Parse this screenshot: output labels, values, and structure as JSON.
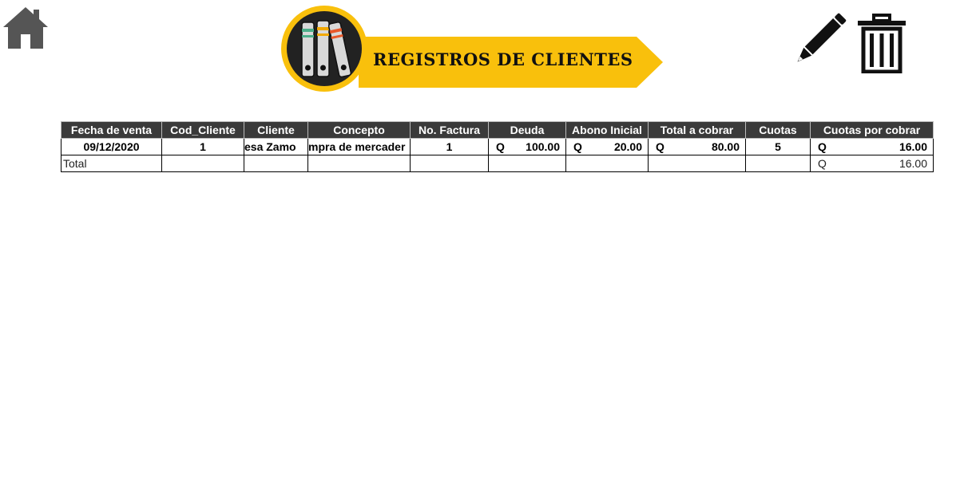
{
  "header": {
    "title": "REGISTROS DE CLIENTES",
    "home_icon": "home-icon",
    "logo_icon": "binders-icon",
    "edit_icon": "pencil-icon",
    "delete_icon": "trash-icon",
    "accent_color": "#f9c00c"
  },
  "table": {
    "columns": [
      "Fecha de venta",
      "Cod_Cliente",
      "Cliente",
      "Concepto",
      "No. Factura",
      "Deuda",
      "Abono Inicial",
      "Total a cobrar",
      "Cuotas",
      "Cuotas por cobrar"
    ],
    "row": {
      "fecha": "09/12/2020",
      "cod_cliente": "1",
      "cliente": "esa Zamo",
      "concepto": "mpra de mercader",
      "factura": "1",
      "deuda_cur": "Q",
      "deuda": "100.00",
      "abono_cur": "Q",
      "abono": "20.00",
      "total_cur": "Q",
      "total": "80.00",
      "cuotas": "5",
      "cuotas_cobrar_cur": "Q",
      "cuotas_cobrar": "16.00"
    },
    "total_row": {
      "label": "Total",
      "cur": "Q",
      "value": "16.00"
    }
  }
}
